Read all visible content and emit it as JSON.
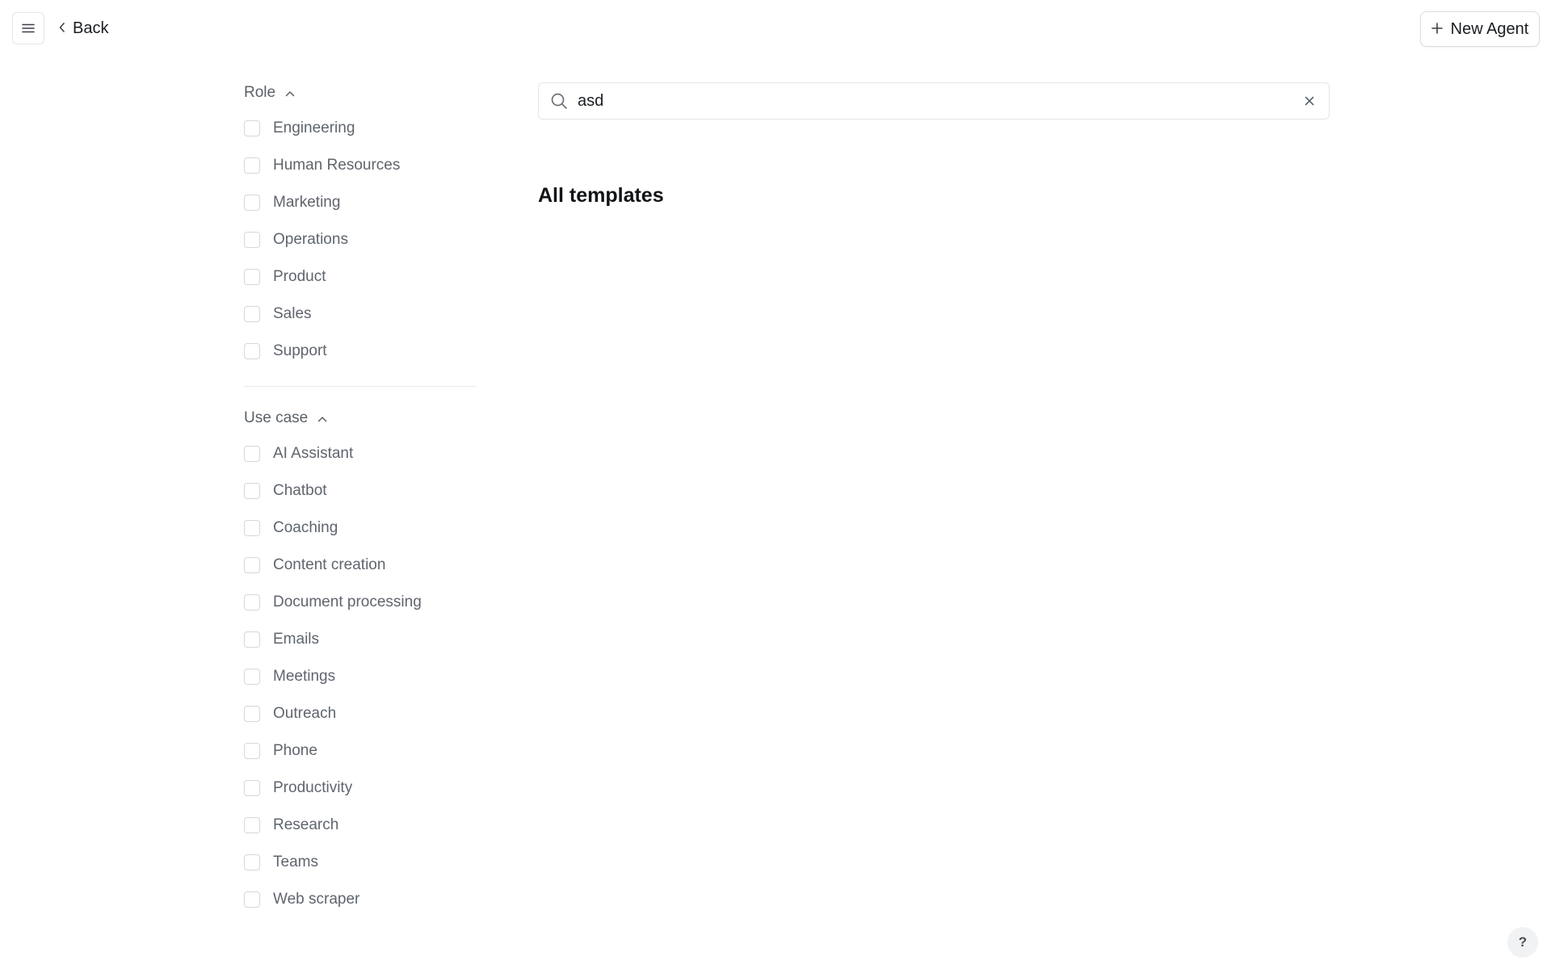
{
  "topbar": {
    "back_label": "Back",
    "new_agent_label": "New Agent"
  },
  "filters": {
    "role": {
      "title": "Role",
      "items": [
        "Engineering",
        "Human Resources",
        "Marketing",
        "Operations",
        "Product",
        "Sales",
        "Support"
      ]
    },
    "use_case": {
      "title": "Use case",
      "items": [
        "AI Assistant",
        "Chatbot",
        "Coaching",
        "Content creation",
        "Document processing",
        "Emails",
        "Meetings",
        "Outreach",
        "Phone",
        "Productivity",
        "Research",
        "Teams",
        "Web scraper"
      ]
    }
  },
  "search": {
    "value": "asd"
  },
  "main": {
    "section_title": "All templates"
  },
  "help": {
    "label": "?"
  }
}
